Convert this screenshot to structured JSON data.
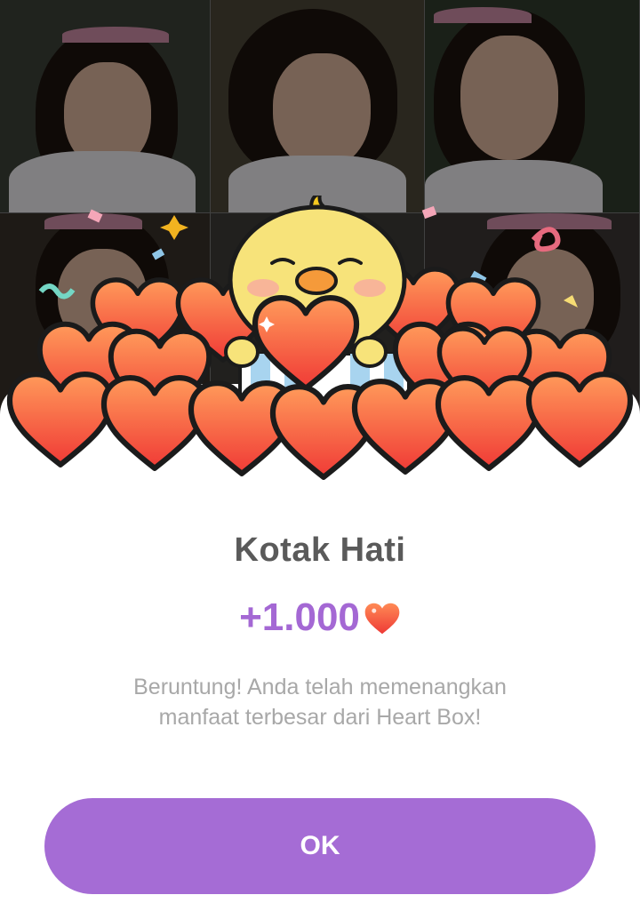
{
  "dialog": {
    "title": "Kotak Hati",
    "amount": "+1.000",
    "description": "Beruntung! Anda telah memenangkan manfaat terbesar dari Heart Box!",
    "ok_label": "OK"
  },
  "icons": {
    "amount_icon": "heart-icon",
    "illustration": "chick-holding-heart-box"
  },
  "colors": {
    "accent": "#a56cd5",
    "amount_text": "#a468d4",
    "heart": "#f2553a"
  }
}
